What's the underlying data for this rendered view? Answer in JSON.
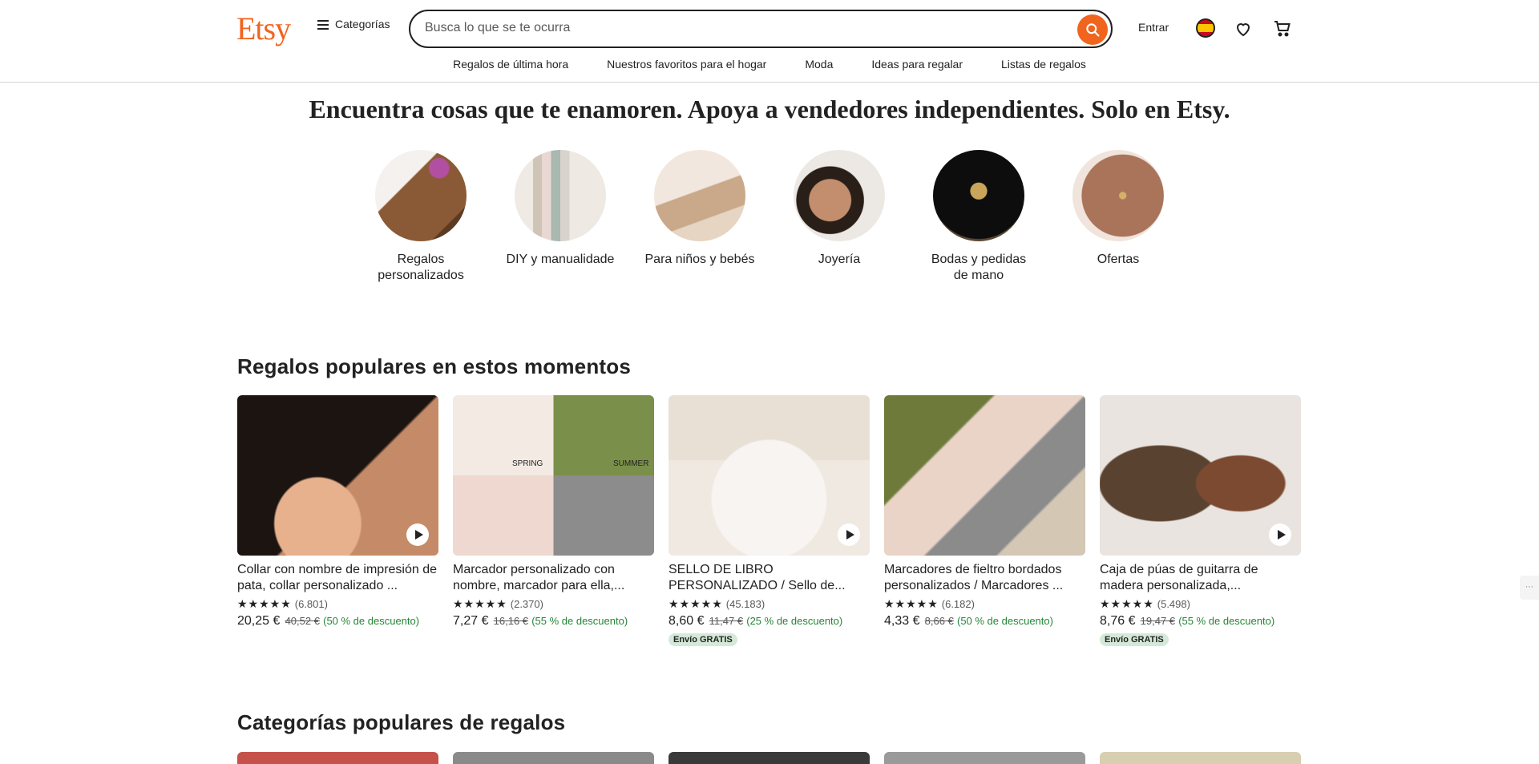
{
  "header": {
    "logo": "Etsy",
    "categories_label": "Categorías",
    "search_placeholder": "Busca lo que se te ocurra",
    "signin_label": "Entrar",
    "subnav": [
      "Regalos de última hora",
      "Nuestros favoritos para el hogar",
      "Moda",
      "Ideas para regalar",
      "Listas de regalos"
    ]
  },
  "hero": {
    "title": "Encuentra cosas que te enamoren. Apoya a vendedores independientes. Solo en Etsy.",
    "circles": [
      {
        "label": "Regalos personalizados"
      },
      {
        "label": "DIY y manualidade"
      },
      {
        "label": "Para niños y bebés"
      },
      {
        "label": "Joyería"
      },
      {
        "label": "Bodas y pedidas de mano"
      },
      {
        "label": "Ofertas"
      }
    ]
  },
  "popular": {
    "title": "Regalos populares en estos momentos",
    "items": [
      {
        "title": "Collar con nombre de impresión de pata, collar personalizado ...",
        "stars": "★★★★★",
        "reviews": "(6.801)",
        "price": "20,25 €",
        "old": "40,52 €",
        "discount": "(50 % de descuento)",
        "badge": "",
        "video": true
      },
      {
        "title": "Marcador personalizado con nombre, marcador para ella,...",
        "stars": "★★★★★",
        "reviews": "(2.370)",
        "price": "7,27 €",
        "old": "16,16 €",
        "discount": "(55 % de descuento)",
        "badge": "",
        "video": false
      },
      {
        "title": "SELLO DE LIBRO PERSONALIZADO / Sello de...",
        "stars": "★★★★★",
        "reviews": "(45.183)",
        "price": "8,60 €",
        "old": "11,47 €",
        "discount": "(25 % de descuento)",
        "badge": "Envío GRATIS",
        "video": true
      },
      {
        "title": "Marcadores de fieltro bordados personalizados / Marcadores ...",
        "stars": "★★★★★",
        "reviews": "(6.182)",
        "price": "4,33 €",
        "old": "8,66 €",
        "discount": "(50 % de descuento)",
        "badge": "",
        "video": false
      },
      {
        "title": "Caja de púas de guitarra de madera personalizada,...",
        "stars": "★★★★★",
        "reviews": "(5.498)",
        "price": "8,76 €",
        "old": "19,47 €",
        "discount": "(55 % de descuento)",
        "badge": "Envío GRATIS",
        "video": true
      }
    ]
  },
  "categories_section": {
    "title": "Categorías populares de regalos"
  },
  "image_labels": {
    "spring": "SPRING",
    "summer": "SUMMER"
  },
  "colors": {
    "brand": "#f1641e",
    "discount": "#258635",
    "badge_bg": "#d4e9d7"
  }
}
